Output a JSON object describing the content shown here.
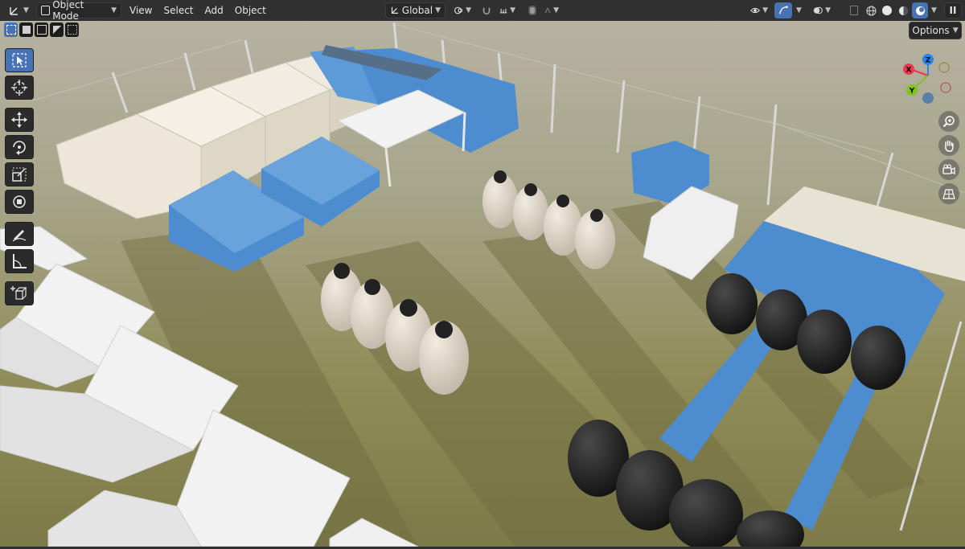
{
  "header": {
    "mode_label": "Object Mode",
    "menus": [
      "View",
      "Select",
      "Add",
      "Object"
    ],
    "orientation_label": "Global",
    "pause_label": "II"
  },
  "tool_settings": {
    "options_label": "Options"
  },
  "gizmo": {
    "axes": {
      "x": "X",
      "y": "Y",
      "z": "Z"
    },
    "colors": {
      "x": "#e8394d",
      "y": "#82c21d",
      "z": "#2f83e4",
      "neg": "#5a7fa8"
    }
  },
  "toolbar": {
    "tools": [
      "select-box",
      "cursor",
      "move",
      "rotate",
      "scale",
      "transform",
      "annotate",
      "measure",
      "add-cube"
    ]
  },
  "navigation": {
    "buttons": [
      "zoom",
      "pan",
      "camera",
      "perspective"
    ]
  },
  "colors": {
    "accent": "#4772b3",
    "tent_blue": "#4d8ccf",
    "tent_white": "#ece7d8",
    "tank_beige": "#d9cfc0",
    "tank_black": "#1c1c1c"
  }
}
